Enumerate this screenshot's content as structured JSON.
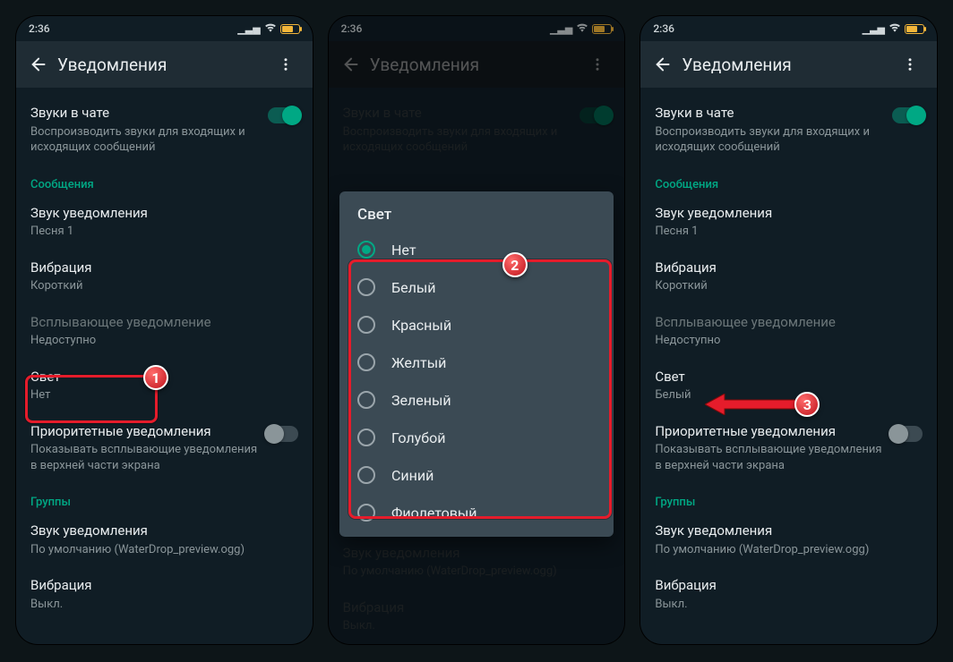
{
  "status": {
    "time": "2:36"
  },
  "appbar": {
    "title": "Уведомления"
  },
  "settings": {
    "chat_sounds": {
      "title": "Звуки в чате",
      "sub": "Воспроизводить звуки для входящих и исходящих сообщений"
    },
    "section_messages": "Сообщения",
    "notif_sound": {
      "title": "Звук уведомления",
      "sub": "Песня 1"
    },
    "vibration": {
      "title": "Вибрация",
      "sub": "Короткий"
    },
    "popup": {
      "title": "Всплывающее уведомление",
      "sub": "Недоступно"
    },
    "light": {
      "title": "Свет",
      "sub_off": "Нет",
      "sub_on": "Белый"
    },
    "priority": {
      "title": "Приоритетные уведомления",
      "sub": "Показывать всплывающие уведомления в верхней части экрана"
    },
    "section_groups": "Группы",
    "group_sound": {
      "title": "Звук уведомления",
      "sub": "По умолчанию (WaterDrop_preview.ogg)"
    },
    "group_vibration": {
      "title": "Вибрация",
      "sub": "Выкл."
    }
  },
  "dialog": {
    "title": "Свет",
    "options": [
      "Нет",
      "Белый",
      "Красный",
      "Желтый",
      "Зеленый",
      "Голубой",
      "Синий",
      "Фиолетовый"
    ],
    "selected": "Нет"
  },
  "callouts": {
    "1": "1",
    "2": "2",
    "3": "3"
  }
}
